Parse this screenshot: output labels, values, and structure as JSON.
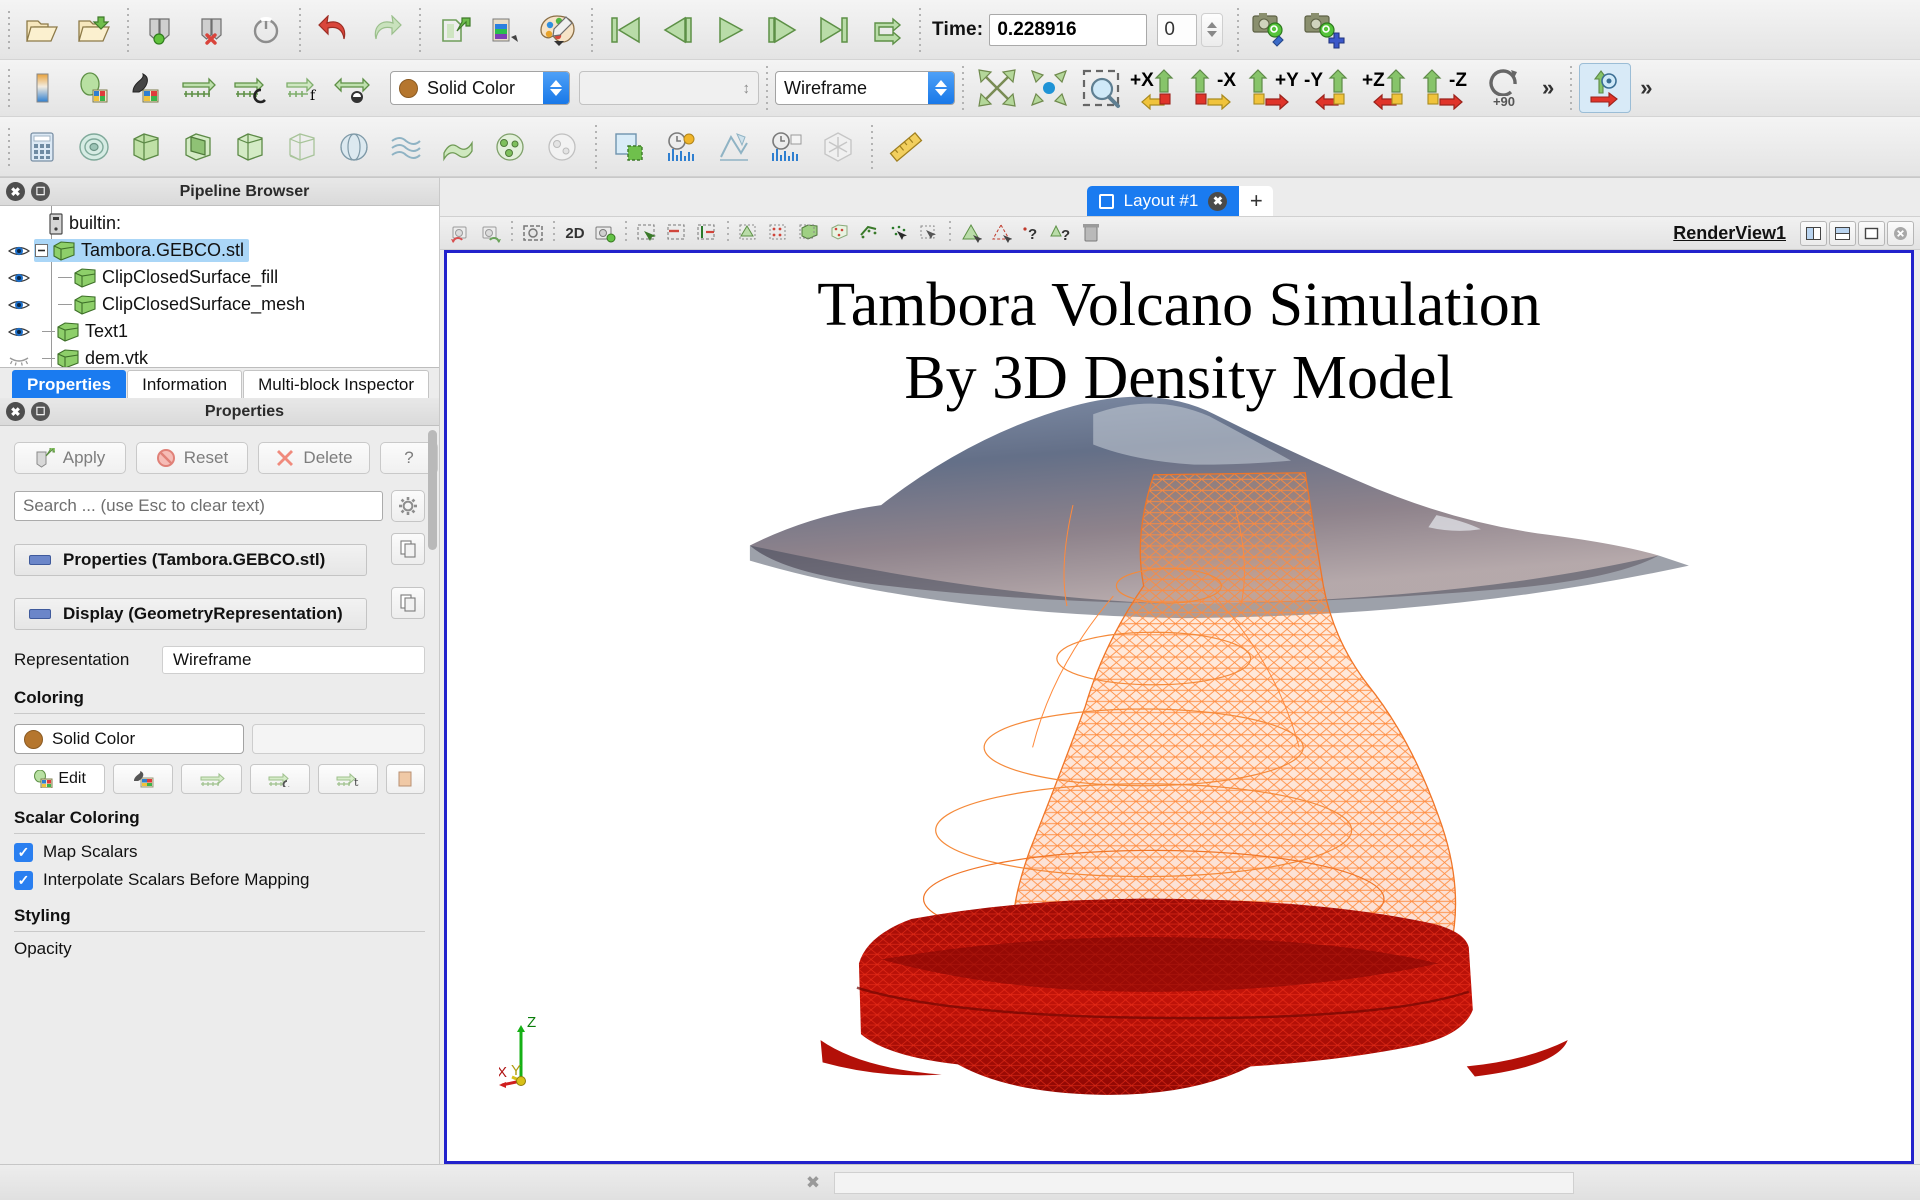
{
  "app": {
    "name": "ParaView",
    "accent_blue": "#1a7bf0",
    "view_border": "#2222cc"
  },
  "toolbar_main": {
    "icons": [
      {
        "name": "open-file-icon",
        "title": "Open"
      },
      {
        "name": "open-recent-icon",
        "title": "Open Recent"
      },
      {
        "name": "save-state-icon",
        "title": "Save State"
      },
      {
        "name": "delete-state-icon",
        "title": "Load State"
      },
      {
        "name": "reset-session-icon",
        "title": "Reset Session"
      },
      {
        "name": "undo-icon",
        "title": "Undo"
      },
      {
        "name": "redo-icon",
        "title": "Redo"
      },
      {
        "name": "undo-camera-icon",
        "title": "Undo Camera"
      },
      {
        "name": "redo-camera-icon",
        "title": "Redo Camera"
      },
      {
        "name": "color-palette-icon",
        "title": "Edit Color Palette"
      }
    ],
    "vcr": [
      {
        "name": "first-frame-button",
        "title": "First Frame"
      },
      {
        "name": "previous-frame-button",
        "title": "Previous Frame"
      },
      {
        "name": "play-button",
        "title": "Play"
      },
      {
        "name": "next-frame-button",
        "title": "Next Frame"
      },
      {
        "name": "last-frame-button",
        "title": "Last Frame"
      },
      {
        "name": "loop-button",
        "title": "Loop"
      }
    ],
    "time_label": "Time:",
    "time_value": "0.228916",
    "frame_value": "0",
    "camera_icons": [
      {
        "name": "adjust-camera-icon"
      },
      {
        "name": "add-camera-icon"
      }
    ]
  },
  "toolbar_repr": {
    "icons": [
      {
        "name": "color-map-icon"
      },
      {
        "name": "color-legend-icon"
      },
      {
        "name": "edit-color-map-icon"
      },
      {
        "name": "rescale-data-range-icon"
      },
      {
        "name": "rescale-custom-range-icon"
      },
      {
        "name": "rescale-temporal-range-icon"
      },
      {
        "name": "rescale-visible-range-icon"
      }
    ],
    "array_combo_value": "Solid Color",
    "component_combo_value": "",
    "representation_combo_value": "Wireframe",
    "camera_icons": [
      {
        "name": "reset-camera-icon"
      },
      {
        "name": "zoom-to-data-icon"
      },
      {
        "name": "zoom-to-box-icon"
      }
    ],
    "axis_buttons": [
      "+X",
      "-X",
      "+Y",
      "-Y",
      "+Z",
      "-Z"
    ],
    "rotate_label": "+90",
    "overflow_label": "»"
  },
  "toolbar_filters": {
    "icons": [
      {
        "name": "calculator-filter-icon"
      },
      {
        "name": "contour-filter-icon"
      },
      {
        "name": "clip-filter-icon"
      },
      {
        "name": "slice-filter-icon"
      },
      {
        "name": "threshold-filter-icon"
      },
      {
        "name": "extract-subset-filter-icon"
      },
      {
        "name": "glyph-filter-icon"
      },
      {
        "name": "stream-tracer-filter-icon"
      },
      {
        "name": "warp-filter-icon"
      },
      {
        "name": "group-datasets-filter-icon"
      },
      {
        "name": "extract-level-filter-icon"
      },
      {
        "name": "extract-block-icon"
      },
      {
        "name": "plot-over-time-icon"
      },
      {
        "name": "plot-data-icon"
      },
      {
        "name": "plot-selection-icon"
      },
      {
        "name": "last-filter-icon"
      },
      {
        "name": "ruler-icon"
      }
    ]
  },
  "pipeline_browser": {
    "title": "Pipeline Browser",
    "items": [
      {
        "label": "builtin:",
        "icon": "server-icon",
        "visible": null,
        "indent": 0,
        "selected": false
      },
      {
        "label": "Tambora.GEBCO.stl",
        "icon": "source-cube-icon",
        "visible": true,
        "indent": 1,
        "selected": true
      },
      {
        "label": "ClipClosedSurface_fill",
        "icon": "source-cube-icon",
        "visible": true,
        "indent": 2,
        "selected": false
      },
      {
        "label": "ClipClosedSurface_mesh",
        "icon": "source-cube-icon",
        "visible": true,
        "indent": 2,
        "selected": false
      },
      {
        "label": "Text1",
        "icon": "source-cube-icon",
        "visible": true,
        "indent": 1,
        "selected": false
      },
      {
        "label": "dem.vtk",
        "icon": "source-cube-icon",
        "visible": false,
        "indent": 1,
        "selected": false
      }
    ]
  },
  "panel_tabs": [
    {
      "label": "Properties",
      "active": true
    },
    {
      "label": "Information",
      "active": false
    },
    {
      "label": "Multi-block Inspector",
      "active": false
    }
  ],
  "properties_panel": {
    "title": "Properties",
    "buttons": [
      {
        "label": "Apply",
        "icon": "apply-icon"
      },
      {
        "label": "Reset",
        "icon": "reset-icon"
      },
      {
        "label": "Delete",
        "icon": "delete-icon"
      },
      {
        "label": "?",
        "icon": "help-icon"
      }
    ],
    "search_placeholder": "Search ... (use Esc to clear text)",
    "search_value": "",
    "gear_icon": "gear-icon",
    "groups": [
      {
        "label": "Properties (Tambora.GEBCO.stl)"
      },
      {
        "label": "Display (GeometryRepresentation)"
      }
    ],
    "representation_label": "Representation",
    "representation_value": "Wireframe",
    "coloring_title": "Coloring",
    "coloring_value": "Solid Color",
    "edit_label": "Edit",
    "scalar_coloring_title": "Scalar Coloring",
    "checkboxes": [
      {
        "label": "Map Scalars",
        "checked": true
      },
      {
        "label": "Interpolate Scalars Before Mapping",
        "checked": true
      }
    ],
    "styling_title": "Styling",
    "opacity_label": "Opacity"
  },
  "layout": {
    "tab_label": "Layout #1",
    "close_label": "✖",
    "add_label": "+"
  },
  "view_toolbar": {
    "icons": [
      {
        "name": "undo-camera-icon"
      },
      {
        "name": "redo-camera-icon"
      },
      {
        "name": "camera-link-icon"
      },
      {
        "name": "toggle-2d-3d-button",
        "label": "2D"
      },
      {
        "name": "camera-capture-icon"
      },
      {
        "name": "select-cells-icon"
      },
      {
        "name": "select-points-icon"
      },
      {
        "name": "select-cells-through-icon"
      },
      {
        "name": "select-points-through-icon"
      },
      {
        "name": "frustum-select-cells-icon"
      },
      {
        "name": "frustum-select-points-icon"
      },
      {
        "name": "select-block-icon"
      },
      {
        "name": "interactive-select-cells-icon"
      },
      {
        "name": "interactive-select-points-icon"
      },
      {
        "name": "hover-cells-icon"
      },
      {
        "name": "hover-points-icon"
      },
      {
        "name": "plot-selection-over-time-icon"
      },
      {
        "name": "select-cells-polygon-icon"
      },
      {
        "name": "select-points-polygon-icon"
      },
      {
        "name": "query-cells-icon"
      },
      {
        "name": "query-points-icon"
      },
      {
        "name": "clear-selection-icon"
      }
    ],
    "render_view_name": "RenderView1",
    "window_buttons": [
      {
        "name": "split-horizontal-button"
      },
      {
        "name": "split-vertical-button"
      },
      {
        "name": "maximize-view-button"
      },
      {
        "name": "close-view-button"
      }
    ]
  },
  "render_view": {
    "title_line1": "Tambora Volcano Simulation",
    "title_line2": "By 3D Density Model",
    "axes": {
      "x": "X",
      "y": "Y",
      "z": "Z"
    }
  },
  "statusbar": {
    "cancel_icon": "cancel-icon",
    "progress_value": ""
  }
}
